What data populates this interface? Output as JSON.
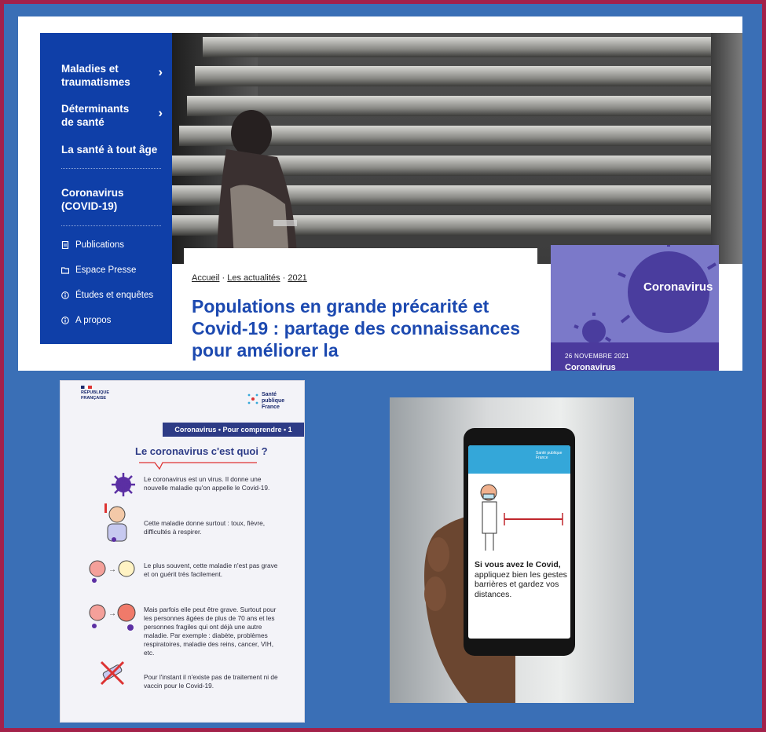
{
  "sidebar": {
    "items": [
      {
        "label": "Maladies et traumatismes",
        "has_chevron": true
      },
      {
        "label": "Déterminants de santé",
        "has_chevron": true
      },
      {
        "label": "La santé à tout âge",
        "has_chevron": false
      },
      {
        "label": "Coronavirus (COVID-19)",
        "has_chevron": false
      }
    ],
    "chevron": "›",
    "links": [
      {
        "label": "Publications",
        "icon": "document-icon"
      },
      {
        "label": "Espace Presse",
        "icon": "folder-icon"
      },
      {
        "label": "Études et enquêtes",
        "icon": "info-icon"
      },
      {
        "label": "A propos",
        "icon": "info-icon"
      }
    ]
  },
  "breadcrumb": {
    "items": [
      "Accueil",
      "Les actualités",
      "2021"
    ],
    "separator": "·"
  },
  "article": {
    "title": "Populations en grande précarité et Covid-19 : partage des connaissances pour améliorer la"
  },
  "card": {
    "label": "Coronavirus",
    "date": "26 NOVEMBRE 2021",
    "title": "Coronavirus"
  },
  "poster": {
    "republique": "RÉPUBLIQUE FRANÇAISE",
    "brand": "Santé publique France",
    "band": "Coronavirus • Pour comprendre • 1",
    "title": "Le coronavirus c'est quoi ?",
    "paragraphs": [
      "Le coronavirus est un virus. Il donne une nouvelle maladie qu'on appelle le Covid-19.",
      "Cette maladie donne surtout : toux, fièvre, difficultés à respirer.",
      "Le plus souvent, cette maladie n'est pas grave et on guérit très facilement.",
      "Mais parfois elle peut être grave. Surtout pour les personnes âgées de plus de 70 ans et les personnes fragiles qui ont déjà une autre maladie. Par exemple : diabète, problèmes respiratoires, maladie des reins, cancer, VIH, etc.",
      "Pour l'instant il n'existe pas de traitement ni de vaccin pour le Covid-19."
    ]
  },
  "phone": {
    "brand": "Santé publique France",
    "message_bold": "Si vous avez le Covid,",
    "message_rest": " appliquez bien les gestes barrières et gardez vos distances."
  },
  "colors": {
    "frame": "#a3214a",
    "background": "#3a6fb6",
    "sidebar": "#0f3fa8",
    "title": "#1c49b0",
    "card": "#7b79c9",
    "poster_band": "#2d3b86"
  }
}
